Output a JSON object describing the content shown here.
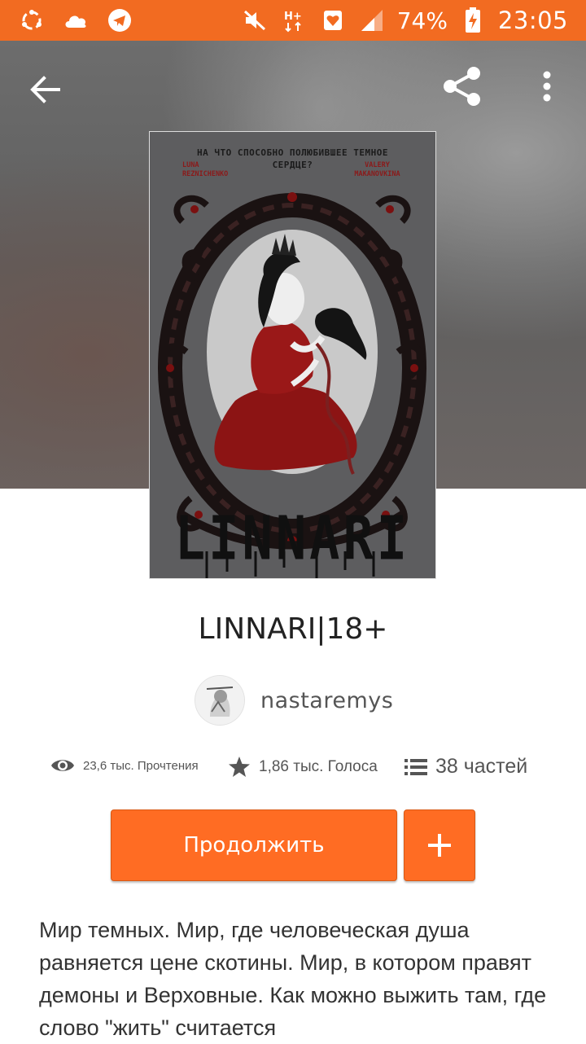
{
  "status_bar": {
    "battery_percent": "74%",
    "time": "23:05",
    "accent_color": "#f26b21"
  },
  "book": {
    "cover": {
      "tagline": "НА ЧТО СПОСОБНО ПОЛЮБИВШЕЕ ТЕМНОЕ СЕРДЦЕ?",
      "author_left": "LUNA REZNICHENKO",
      "author_right": "VALERY MAKANOVKINA",
      "title": "LINNARI"
    },
    "title": "LINNARI|18+",
    "author": "nastaremys",
    "stats": {
      "reads": "23,6 тыс. Прочтения",
      "votes": "1,86 тыс. Голоса",
      "parts": "38 частей"
    },
    "continue_label": "Продолжить",
    "add_label": "+",
    "description": "Мир темных. Мир, где человеческая душа равняется цене скотины. Мир, в котором правят демоны и Верховные. Как можно выжить там, где слово \"жить\" считается"
  },
  "icons": {
    "back": "arrow-left-icon",
    "share": "share-icon",
    "more": "more-vert-icon",
    "reads": "eye-icon",
    "votes": "star-icon",
    "parts": "list-icon"
  },
  "colors": {
    "button": "#ff6c23"
  }
}
